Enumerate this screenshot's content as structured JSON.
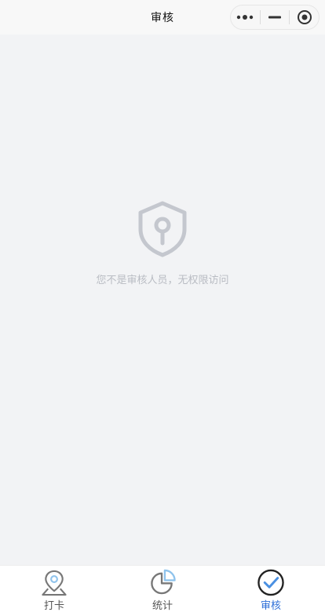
{
  "nav": {
    "title": "审核"
  },
  "empty_state": {
    "message": "您不是审核人员，无权限访问",
    "icon": "shield-lock-icon"
  },
  "tabs": [
    {
      "label": "打卡",
      "icon": "location-pin-icon",
      "active": false
    },
    {
      "label": "统计",
      "icon": "pie-chart-icon",
      "active": false
    },
    {
      "label": "审核",
      "icon": "check-circle-icon",
      "active": true
    }
  ],
  "colors": {
    "active": "#2e6fd8",
    "inactive": "#555555",
    "empty_icon": "#c4c7ce",
    "background": "#f2f3f5"
  }
}
